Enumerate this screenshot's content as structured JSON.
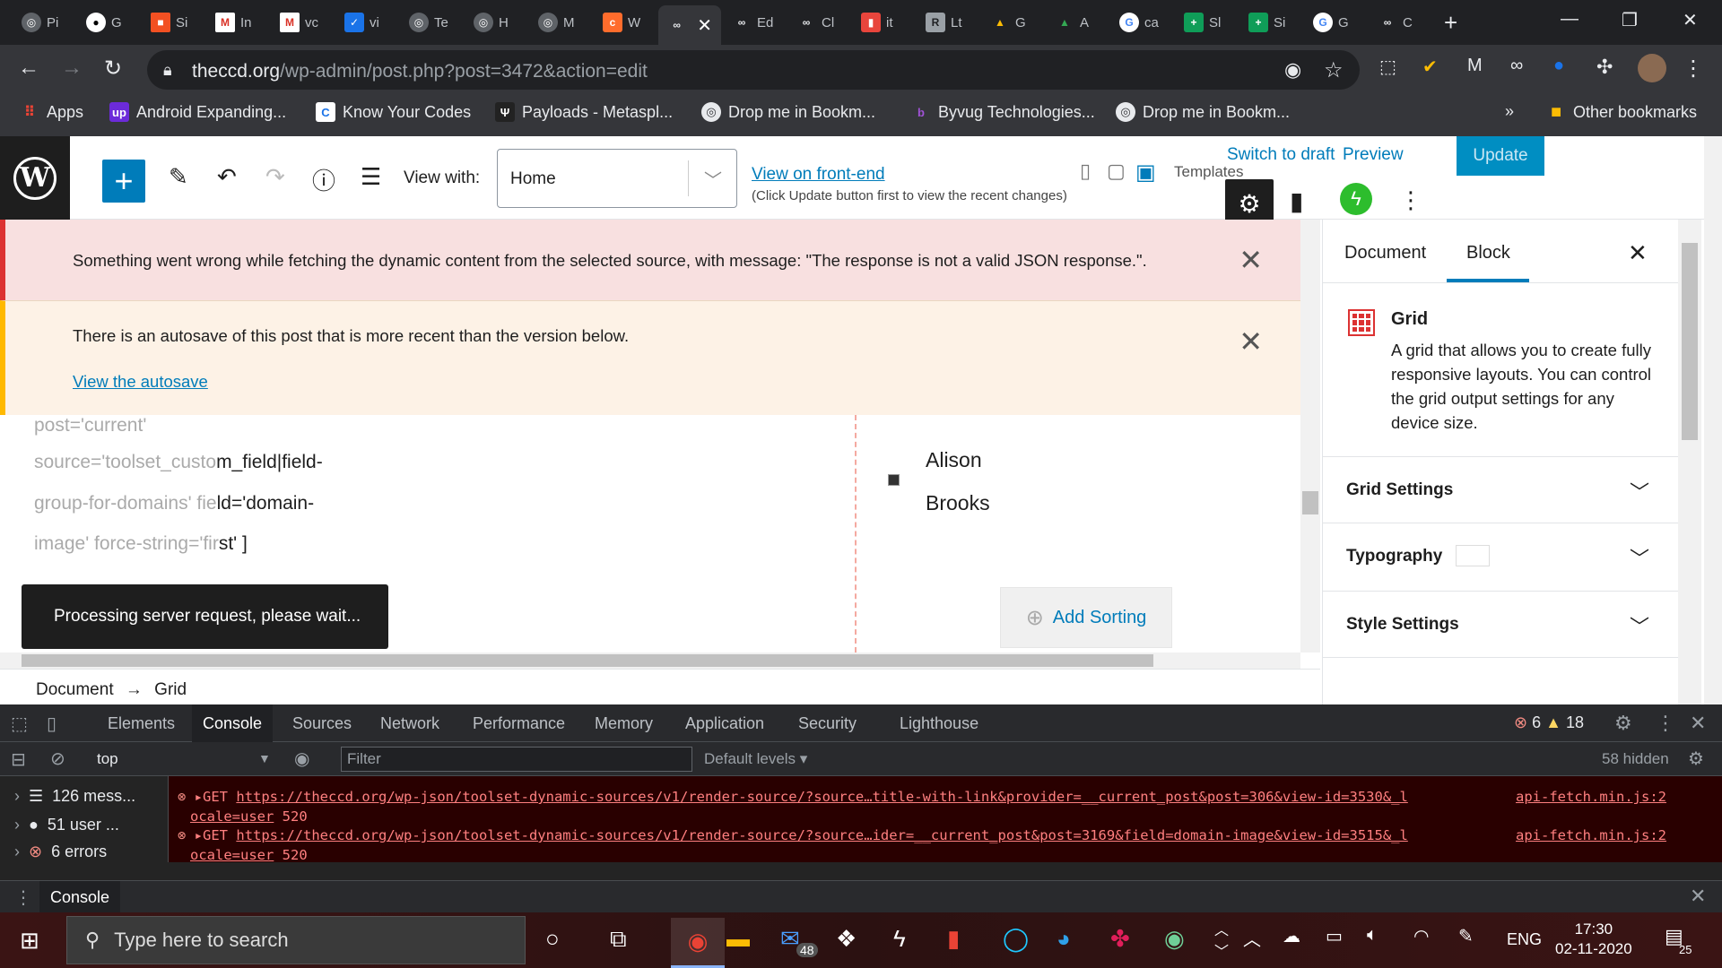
{
  "browser": {
    "tabs": [
      "Pi",
      "G",
      "Si",
      "In",
      "vc",
      "vi",
      "Te",
      "H",
      "M",
      "W",
      "",
      "Ed",
      "Cl",
      "it",
      "Lt",
      "G",
      "A",
      "ca",
      "Sl",
      "Si",
      "G",
      "C"
    ],
    "url_host": "theccd.org",
    "url_path": "/wp-admin/post.php?post=3472&action=edit"
  },
  "bookmarks": {
    "apps": "Apps",
    "items": [
      "Android Expanding...",
      "Know Your Codes",
      "Payloads - Metaspl...",
      "Drop me in Bookm...",
      "Byvug Technologies...",
      "Drop me in Bookm..."
    ],
    "more": "»",
    "other": "Other bookmarks"
  },
  "wp": {
    "view_with_label": "View with:",
    "view_with_value": "Home",
    "view_front_end": "View on front-end",
    "view_hint": "(Click Update button first to view the recent changes)",
    "switch_to_draft": "Switch to draft",
    "preview": "Preview",
    "update": "Update",
    "templates": "Templates"
  },
  "notices": {
    "error": "Something went wrong while fetching the dynamic content from the selected source, with message: \"The response is not a valid JSON response.\".",
    "autosave": "There is an autosave of this post that is more recent than the version below.",
    "autosave_link": "View the autosave"
  },
  "canvas": {
    "code_lines": [
      {
        "dim": "post='current'",
        "dark": ""
      },
      {
        "dim": "source='toolset_custo",
        "dark": "m_field|field-"
      },
      {
        "dim": "group-for-domains' fie",
        "dark": "ld='domain-"
      },
      {
        "dim": "image' force-string='fir",
        "dark": "st' ]"
      }
    ],
    "names": [
      "Alison",
      "Brooks"
    ],
    "add_sorting": "Add Sorting",
    "toast": "Processing server request, please wait..."
  },
  "breadcrumb": {
    "root": "Document",
    "arrow": "→",
    "current": "Grid"
  },
  "sidebar": {
    "tab_document": "Document",
    "tab_block": "Block",
    "block_title": "Grid",
    "block_desc": "A grid that allows you to create fully responsive layouts. You can control the grid output settings for any device size.",
    "panels": [
      "Grid Settings",
      "Typography",
      "Style Settings"
    ]
  },
  "devtools": {
    "tabs": [
      "Elements",
      "Console",
      "Sources",
      "Network",
      "Performance",
      "Memory",
      "Application",
      "Security",
      "Lighthouse"
    ],
    "error_count": "6",
    "warn_count": "18",
    "context": "top",
    "filter_placeholder": "Filter",
    "levels": "Default levels ▾",
    "hidden": "58 hidden",
    "sidebar_items": [
      "126 mess...",
      "51 user ...",
      "6 errors"
    ],
    "errors": [
      {
        "method": "GET",
        "url_a": "https://theccd.org/wp-json/toolset-dynamic-sources/v1/render-source/?source…title-with-link&provider=__current_post&post=306&view-id=3530&_l",
        "url_b": "ocale=user",
        "status": "520",
        "source": "api-fetch.min.js:2"
      },
      {
        "method": "GET",
        "url_a": "https://theccd.org/wp-json/toolset-dynamic-sources/v1/render-source/?source…ider=__current_post&post=3169&field=domain-image&view-id=3515&_l",
        "url_b": "ocale=user",
        "status": "520",
        "source": "api-fetch.min.js:2"
      }
    ],
    "drawer_tab": "Console"
  },
  "taskbar": {
    "search_placeholder": "Type here to search",
    "mail_badge": "48",
    "lang": "ENG",
    "time": "17:30",
    "date": "02-11-2020",
    "notif_count": "25"
  }
}
